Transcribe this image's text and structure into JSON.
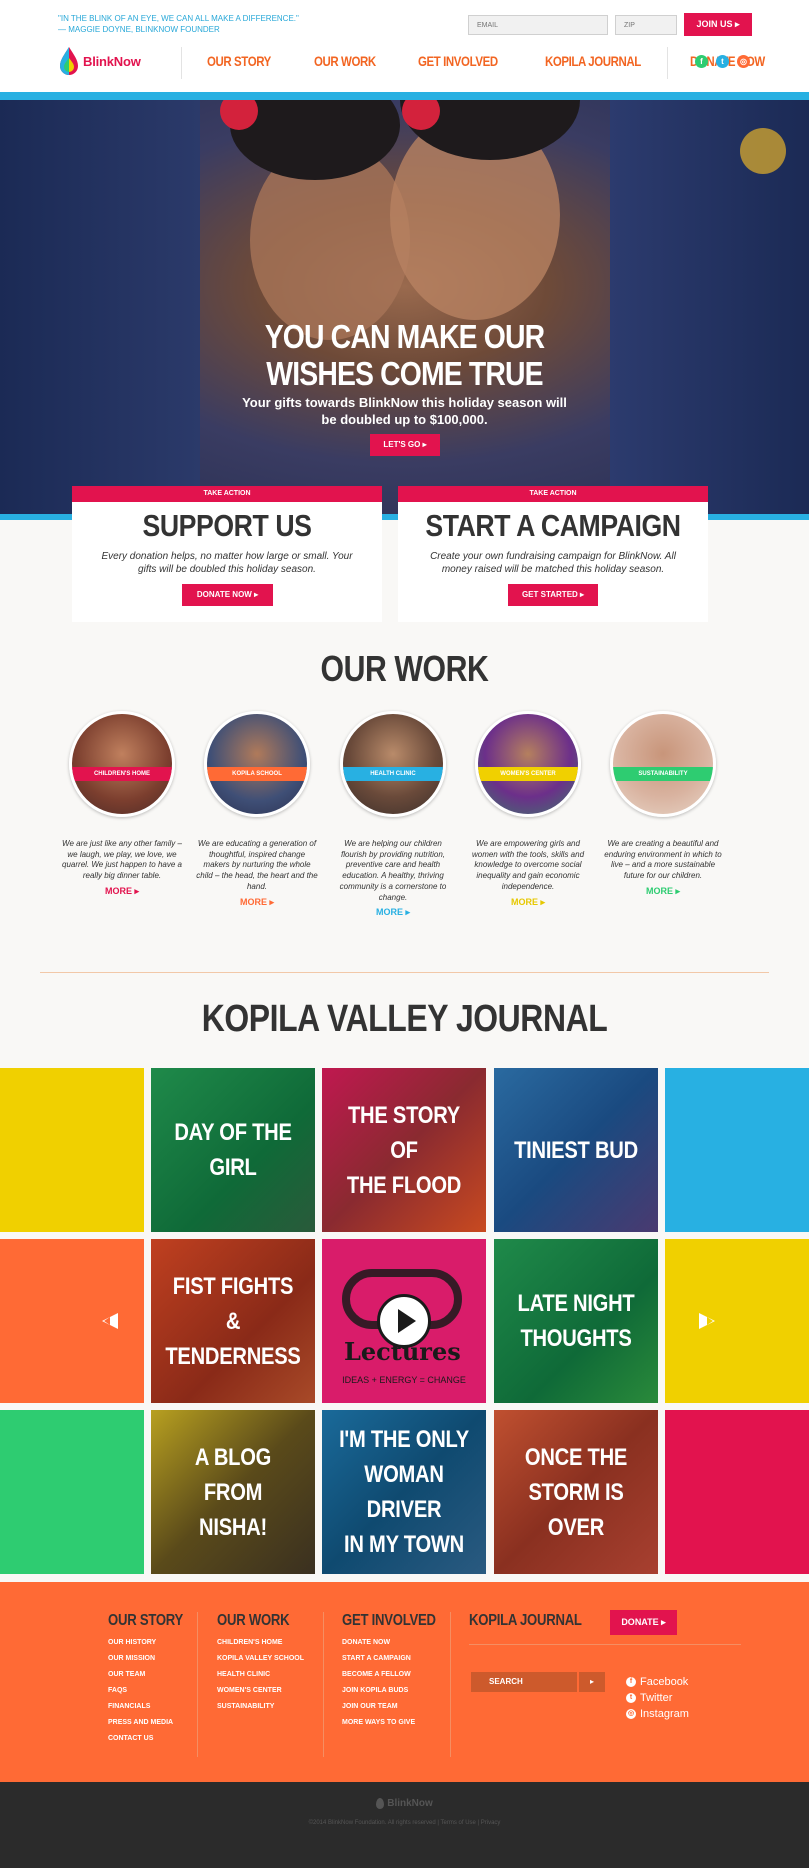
{
  "header": {
    "quote_line1": "\"IN THE BLINK OF AN EYE, WE CAN ALL MAKE A DIFFERENCE.\"",
    "quote_line2": "— MAGGIE DOYNE, BLINKNOW FOUNDER",
    "email_placeholder": "EMAIL",
    "zip_placeholder": "ZIP",
    "join_label": "JOIN US ▸",
    "logo_text": "BlinkNow",
    "nav": [
      "OUR STORY",
      "OUR WORK",
      "GET INVOLVED",
      "KOPILA JOURNAL",
      "DONATE NOW"
    ],
    "social_icons": [
      "facebook-icon",
      "twitter-icon",
      "instagram-icon"
    ]
  },
  "hero": {
    "title_line1": "YOU CAN MAKE OUR",
    "title_line2": "WISHES COME TRUE",
    "sub_line1": "Your gifts towards BlinkNow this holiday season will",
    "sub_line2": "be doubled up to $100,000.",
    "cta": "LET'S GO ▸"
  },
  "cards": [
    {
      "tag": "TAKE ACTION",
      "title": "SUPPORT US",
      "text_line1": "Every donation helps, no matter how large or small. Your",
      "text_line2": "gifts will be doubled this holiday season.",
      "button": "DONATE NOW ▸"
    },
    {
      "tag": "TAKE ACTION",
      "title": "START A CAMPAIGN",
      "text_line1": "Create your own fundraising campaign for BlinkNow. All",
      "text_line2": "money raised will be matched this holiday season.",
      "button": "GET STARTED ▸"
    }
  ],
  "our_work": {
    "title": "OUR WORK",
    "items": [
      {
        "label": "CHILDREN'S HOME",
        "color": "#e2134e",
        "text": "We are just like any other family – we laugh, we play, we love, we quarrel. We just happen to have a really big dinner table.",
        "more": "MORE ▸"
      },
      {
        "label": "KOPILA SCHOOL",
        "color": "#ff6a35",
        "text": "We are educating a generation of thoughtful, inspired change makers by nurturing the whole child – the head, the heart and the hand.",
        "more": "MORE ▸"
      },
      {
        "label": "HEALTH CLINIC",
        "color": "#28b0e2",
        "text": "We are helping our children flourish by providing nutrition, preventive care and health education. A healthy, thriving community is a cornerstone to change.",
        "more": "MORE ▸"
      },
      {
        "label": "WOMEN'S CENTER",
        "color": "#f0d000",
        "text": "We are empowering girls and women with the tools, skills and knowledge to overcome social inequality and gain economic independence.",
        "more": "MORE ▸"
      },
      {
        "label": "SUSTAINABILITY",
        "color": "#2ecc71",
        "text": "We are creating a beautiful and enduring environment in which to live – and a more sustainable future for our children.",
        "more": "MORE ▸"
      }
    ]
  },
  "journal": {
    "title": "KOPILA VALLEY JOURNAL",
    "posts": [
      {
        "title": "DAY OF THE GIRL",
        "lines": [
          "DAY OF THE",
          "GIRL"
        ]
      },
      {
        "title": "THE STORY OF THE FLOOD",
        "lines": [
          "THE STORY OF",
          "THE FLOOD"
        ]
      },
      {
        "title": "TINIEST BUD",
        "lines": [
          "TINIEST BUD"
        ]
      },
      {
        "title": "FIST FIGHTS & TENDERNESS",
        "lines": [
          "FIST FIGHTS &",
          "TENDERNESS"
        ]
      },
      {
        "title": "Lectures",
        "video_sub": "IDEAS + ENERGY = CHANGE",
        "lines": [
          "Lectures"
        ]
      },
      {
        "title": "LATE NIGHT THOUGHTS",
        "lines": [
          "LATE NIGHT",
          "THOUGHTS"
        ]
      },
      {
        "title": "A BLOG FROM NISHA!",
        "lines": [
          "A BLOG FROM",
          "NISHA!"
        ]
      },
      {
        "title": "I'M THE ONLY WOMAN DRIVER IN MY TOWN",
        "lines": [
          "I'M THE ONLY",
          "WOMAN DRIVER",
          "IN MY TOWN"
        ]
      },
      {
        "title": "ONCE THE STORM IS OVER",
        "lines": [
          "ONCE THE",
          "STORM IS OVER"
        ]
      }
    ]
  },
  "footer": {
    "columns": [
      {
        "head": "OUR STORY",
        "links": [
          "OUR HISTORY",
          "OUR MISSION",
          "OUR TEAM",
          "FAQS",
          "FINANCIALS",
          "PRESS AND MEDIA",
          "CONTACT US"
        ]
      },
      {
        "head": "OUR WORK",
        "links": [
          "CHILDREN'S HOME",
          "KOPILA VALLEY SCHOOL",
          "HEALTH CLINIC",
          "WOMEN'S CENTER",
          "SUSTAINABILITY"
        ]
      },
      {
        "head": "GET INVOLVED",
        "links": [
          "DONATE NOW",
          "START A CAMPAIGN",
          "BECOME A FELLOW",
          "JOIN KOPILA BUDS",
          "JOIN OUR TEAM",
          "MORE WAYS TO GIVE"
        ]
      }
    ],
    "journal_head": "KOPILA JOURNAL",
    "donate": "DONATE ▸",
    "search_placeholder": "SEARCH",
    "search_go": "▸",
    "social": [
      "Facebook",
      "Twitter",
      "Instagram"
    ],
    "bottom_logo": "BlinkNow",
    "copyright": "©2014 BlinkNow Foundation. All rights reserved  |  Terms of Use  |  Privacy"
  }
}
